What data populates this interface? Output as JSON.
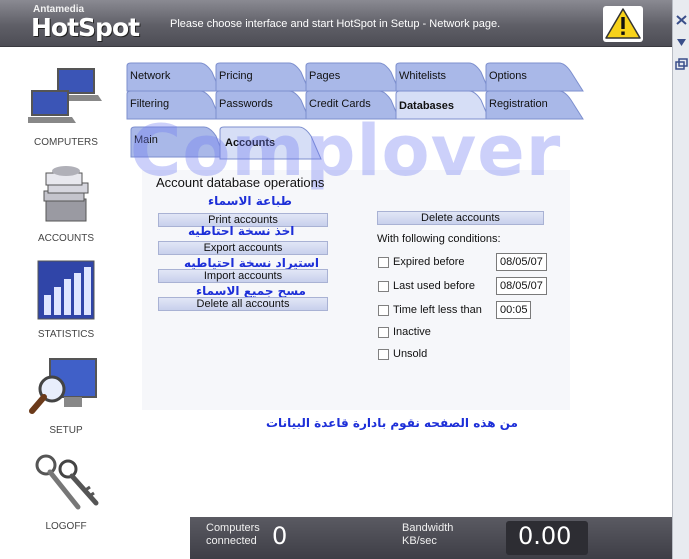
{
  "header": {
    "brand_small": "Antamedia",
    "brand_big": "HotSpot",
    "message": "Please choose interface and start HotSpot in Setup - Network page."
  },
  "sidebar": {
    "items": [
      {
        "label": "COMPUTERS",
        "icon": "computers-icon"
      },
      {
        "label": "ACCOUNTS",
        "icon": "accounts-icon"
      },
      {
        "label": "STATISTICS",
        "icon": "statistics-icon"
      },
      {
        "label": "SETUP",
        "icon": "setup-icon"
      },
      {
        "label": "LOGOFF",
        "icon": "logoff-icon"
      }
    ]
  },
  "tabs": {
    "row1": [
      "Network",
      "Pricing",
      "Pages",
      "Whitelists",
      "Options"
    ],
    "row2": [
      "Filtering",
      "Passwords",
      "Credit Cards",
      "Databases",
      "Registration"
    ],
    "row3": [
      "Main",
      "Accounts"
    ],
    "active_row2": "Databases",
    "active_row3": "Accounts"
  },
  "watermark": "Complover",
  "section_title": "Account database operations",
  "operations": {
    "buttons": [
      "Print accounts",
      "Export accounts",
      "Import accounts",
      "Delete all accounts"
    ],
    "arabic_notes": [
      "طباعة الاسماء",
      "اخذ نسخة احتاطيه",
      "استيراد نسخة احتياطيه",
      "مسح جميع الاسماء"
    ]
  },
  "delete": {
    "button": "Delete accounts",
    "conditions_label": "With following conditions:",
    "conditions": [
      {
        "label": "Expired before",
        "value": "08/05/07"
      },
      {
        "label": "Last used before",
        "value": "08/05/07"
      },
      {
        "label": "Time left less than",
        "value": "00:05"
      },
      {
        "label": "Inactive"
      },
      {
        "label": "Unsold"
      }
    ]
  },
  "bottom_note": "من هذه الصفحه نقوم بادارة قاعدة البيانات",
  "status": {
    "computers_label_1": "Computers",
    "computers_label_2": "connected",
    "computers_value": "0",
    "bandwidth_label_1": "Bandwidth",
    "bandwidth_label_2": "KB/sec",
    "bandwidth_value": "0.00"
  },
  "colors": {
    "tab_fill": "#a9b8e8",
    "tab_active": "#d6def6",
    "arabic_text": "#1d2fd8",
    "watermark": "#6e78f0"
  }
}
